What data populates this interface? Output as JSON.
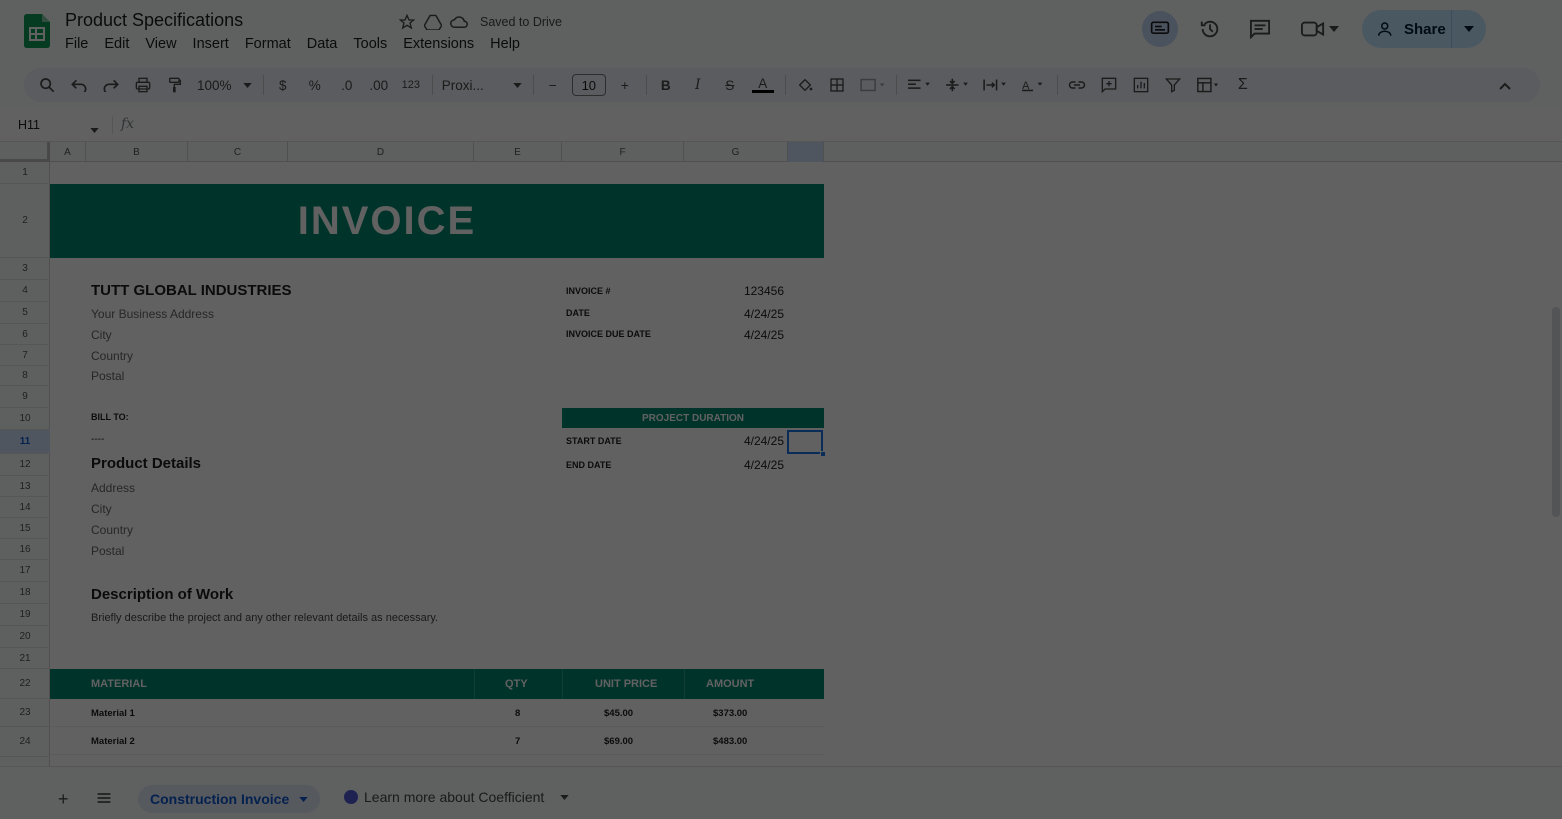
{
  "app": {
    "title": "Product Specifications",
    "saved_status": "Saved to Drive",
    "accent_color": "#00866e"
  },
  "menu": [
    "File",
    "Edit",
    "View",
    "Insert",
    "Format",
    "Data",
    "Tools",
    "Extensions",
    "Help"
  ],
  "header_actions": {
    "share_label": "Share"
  },
  "toolbar": {
    "zoom": "100%",
    "currency": "$",
    "percent": "%",
    "dec_decrease": ".0",
    "dec_increase": ".00",
    "number_format": "123",
    "font": "Proxi...",
    "font_size": "10"
  },
  "formula_bar": {
    "name_box": "H11",
    "fx": "fx"
  },
  "grid": {
    "columns": [
      "A",
      "B",
      "C",
      "D",
      "E",
      "F",
      "G"
    ],
    "rows": [
      "1",
      "2",
      "3",
      "4",
      "5",
      "6",
      "7",
      "8",
      "9",
      "10",
      "11",
      "12",
      "13",
      "14",
      "15",
      "16",
      "17",
      "18",
      "19",
      "20",
      "21",
      "22",
      "23",
      "24"
    ],
    "selected_row": "11"
  },
  "invoice": {
    "banner": "INVOICE",
    "company": "TUTT GLOBAL INDUSTRIES",
    "address_lines": [
      "Your Business Address",
      "City",
      "Country",
      "Postal"
    ],
    "meta": [
      {
        "label": "INVOICE #",
        "value": "123456"
      },
      {
        "label": "DATE",
        "value": "4/24/25"
      },
      {
        "label": "INVOICE DUE DATE",
        "value": "4/24/25"
      }
    ],
    "bill_to": "BILL TO:",
    "bill_to_value": "----",
    "project_duration_header": "PROJECT DURATION",
    "duration": [
      {
        "label": "START DATE",
        "value": "4/24/25"
      },
      {
        "label": "END DATE",
        "value": "4/24/25"
      }
    ],
    "product_details_title": "Product Details",
    "product_lines": [
      "Address",
      "City",
      "Country",
      "Postal"
    ],
    "description_title": "Description of Work",
    "description_text": "Briefly describe the project and any other relevant details as necessary.",
    "table_headers": [
      "MATERIAL",
      "QTY",
      "UNIT PRICE",
      "AMOUNT"
    ],
    "table_rows": [
      {
        "material": "Material 1",
        "qty": "8",
        "unit_price": "$45.00",
        "amount": "$373.00"
      },
      {
        "material": "Material 2",
        "qty": "7",
        "unit_price": "$69.00",
        "amount": "$483.00"
      }
    ]
  },
  "tabs": {
    "active": "Construction Invoice",
    "second": "Learn more about Coefficient"
  }
}
